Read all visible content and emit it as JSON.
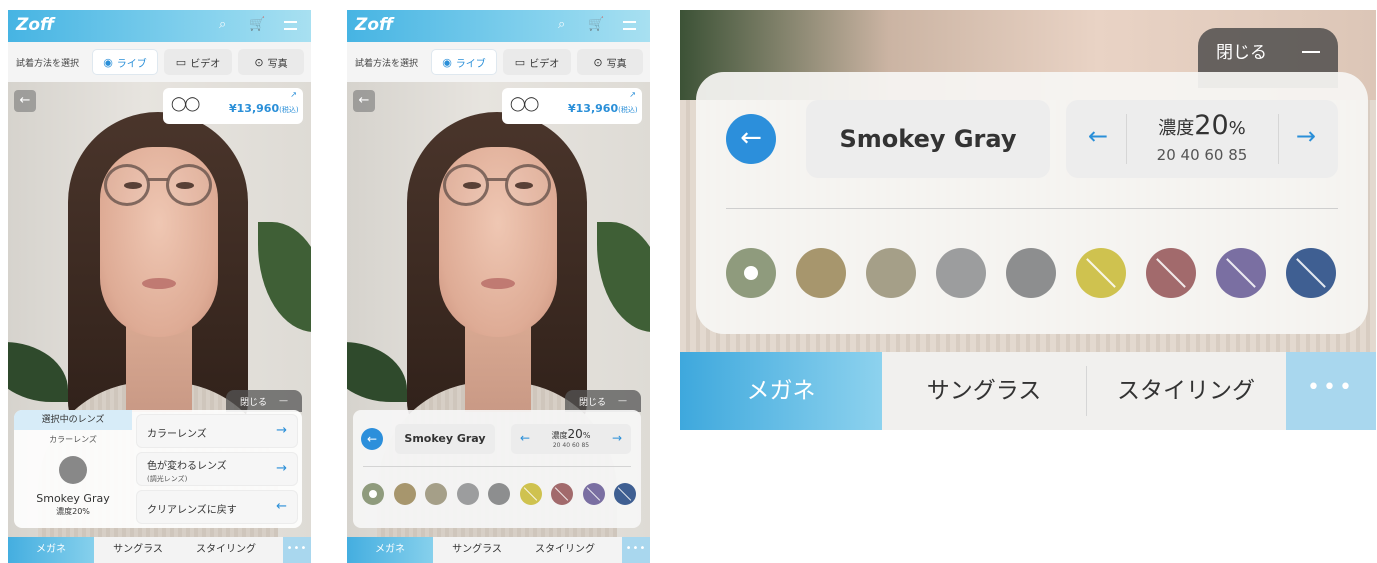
{
  "header": {
    "logo": "Zoff",
    "search_icon": "search-icon",
    "cart_icon": "cart-icon",
    "menu_icon": "menu-icon"
  },
  "mode": {
    "label": "試着方法を選択",
    "options": [
      {
        "label": "ライブ",
        "icon": "live-icon",
        "active": true
      },
      {
        "label": "ビデオ",
        "icon": "video-icon",
        "active": false
      },
      {
        "label": "写真",
        "icon": "camera-icon",
        "active": false
      }
    ]
  },
  "product": {
    "price": "¥13,960",
    "tax": "(税込)"
  },
  "close_label": "閉じる",
  "lens_select": {
    "heading": "選択中のレンズ",
    "category": "カラーレンズ",
    "lens_name": "Smokey Gray",
    "density": "濃度20%",
    "options": [
      {
        "label": "カラーレンズ",
        "sub": ""
      },
      {
        "label": "色が変わるレンズ",
        "sub": "(調光レンズ)"
      },
      {
        "label": "クリアレンズに戻す",
        "sub": ""
      }
    ]
  },
  "color_picker": {
    "lens_name": "Smokey Gray",
    "density_prefix": "濃度",
    "density_value": "20",
    "density_unit": "%",
    "density_options": "20 40 60 85",
    "swatches": [
      {
        "color": "#8f9b7d",
        "selected": true,
        "gradient": false
      },
      {
        "color": "#a7966d",
        "selected": false,
        "gradient": false
      },
      {
        "color": "#a59f88",
        "selected": false,
        "gradient": false
      },
      {
        "color": "#9c9d9e",
        "selected": false,
        "gradient": false
      },
      {
        "color": "#8d8e8f",
        "selected": false,
        "gradient": false
      },
      {
        "color": "#cfc24f",
        "selected": false,
        "gradient": true
      },
      {
        "color": "#a26a6c",
        "selected": false,
        "gradient": true
      },
      {
        "color": "#7a6fa2",
        "selected": false,
        "gradient": true
      },
      {
        "color": "#3f5f92",
        "selected": false,
        "gradient": true
      }
    ]
  },
  "nav": {
    "tabs": [
      "メガネ",
      "サングラス",
      "スタイリング"
    ],
    "more": "•••"
  },
  "colors": {
    "accent": "#2a8fd8",
    "header": "#46b4e3"
  }
}
